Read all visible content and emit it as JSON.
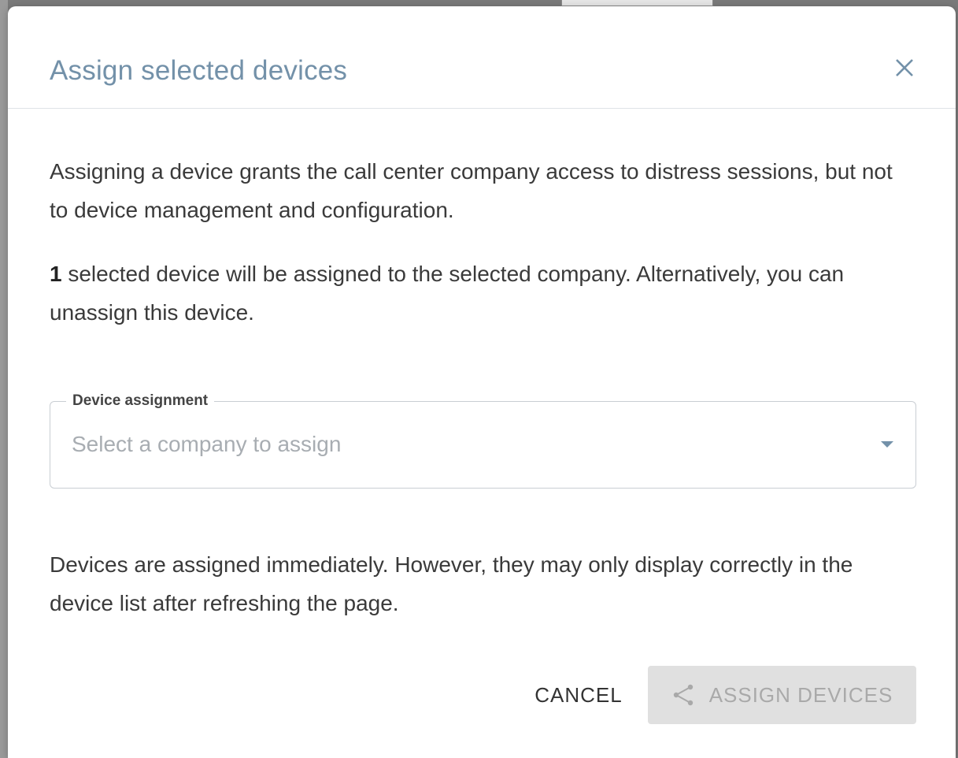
{
  "dialog": {
    "title": "Assign selected devices",
    "paragraph1": "Assigning a device grants the call center company access to distress sessions, but not to device management and configuration.",
    "selection_count": "1",
    "paragraph2_rest": " selected device will be assigned to the selected company. Alternatively, you can unassign this device.",
    "paragraph3": "Devices are assigned immediately. However, they may only display correctly in the device list after refreshing the page.",
    "field": {
      "label": "Device assignment",
      "placeholder": "Select a company to assign"
    },
    "buttons": {
      "cancel": "CANCEL",
      "assign": "ASSIGN DEVICES"
    }
  },
  "icons": {
    "close": "close-icon",
    "dropdown": "caret-down-icon",
    "assign": "share-icon"
  },
  "colors": {
    "title": "#7391a9",
    "disabled_button_bg": "#e0e0e0",
    "disabled_button_text": "#a9a9a9"
  }
}
